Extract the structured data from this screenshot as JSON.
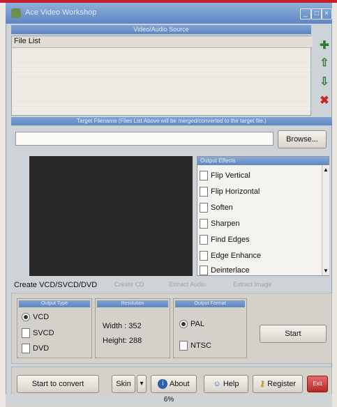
{
  "window": {
    "title": "Ace Video Workshop",
    "controls": {
      "minimize": "_",
      "maximize": "□",
      "close": "×"
    }
  },
  "source": {
    "header": "Video/Audio Source",
    "file_list_label": "File List",
    "side_buttons": [
      {
        "icon": "plus-icon",
        "glyph": "✚",
        "color": "#2e7d32"
      },
      {
        "icon": "arrow-up-icon",
        "glyph": "⇧",
        "color": "#2e7d32"
      },
      {
        "icon": "arrow-down-icon",
        "glyph": "⇩",
        "color": "#2e7d32"
      },
      {
        "icon": "delete-icon",
        "glyph": "✖",
        "color": "#c62828"
      }
    ]
  },
  "target": {
    "header": "Target Filename (Files List Above will be merged/converted to the target file.)",
    "path_value": "",
    "browse_label": "Browse..."
  },
  "effects": {
    "header": "Output Effects",
    "items": [
      "Flip Vertical",
      "Flip Horizontal",
      "Soften",
      "Sharpen",
      "Find Edges",
      "Edge Enhance",
      "Deinterlace"
    ]
  },
  "tabs": [
    "Create VCD/SVCD/DVD",
    "Create CD",
    "Extract Audio",
    "Extract Image"
  ],
  "output_type": {
    "header": "Output Type",
    "options": [
      {
        "label": "VCD",
        "checked": true
      },
      {
        "label": "SVCD",
        "checked": false
      },
      {
        "label": "DVD",
        "checked": false
      }
    ]
  },
  "resolution": {
    "header": "Resolution",
    "width": "Width : 352",
    "height": "Height: 288"
  },
  "output_format": {
    "header": "Output Format",
    "options": [
      {
        "label": "PAL",
        "checked": true
      },
      {
        "label": "NTSC",
        "checked": false
      }
    ]
  },
  "buttons": {
    "start": "Start",
    "start_convert": "Start to convert",
    "skin": "Skin",
    "about": "About",
    "help": "Help",
    "register": "Register",
    "exit_badge": "Exit"
  },
  "status": {
    "text": "6%"
  },
  "colors": {
    "title_bar": "#6e93cc",
    "window_bg": "#cdd3d6",
    "preview_bg": "#2a2826",
    "frame_red": "#c8212e"
  }
}
